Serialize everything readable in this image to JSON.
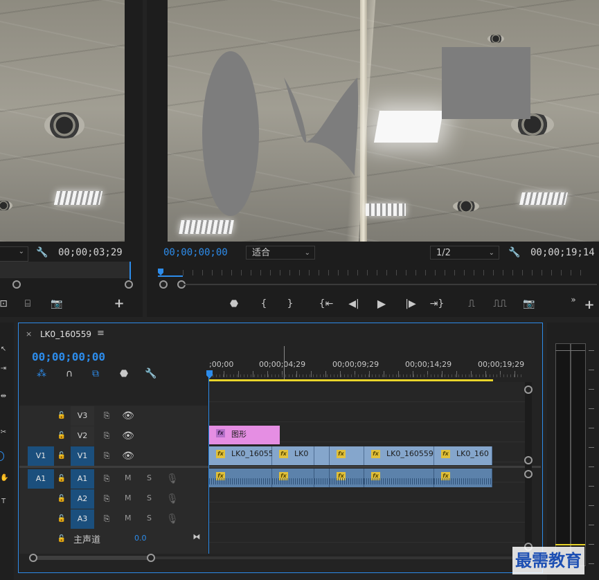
{
  "source_monitor": {
    "fit_value": "",
    "timecode": "00;00;03;29"
  },
  "program_monitor": {
    "playhead_timecode": "00;00;00;00",
    "fit_label": "适合",
    "resolution": "1/2",
    "duration_timecode": "00;00;19;14"
  },
  "timeline": {
    "sequence_name": "LK0_160559",
    "playhead_timecode": "00;00;00;00",
    "ruler_labels": [
      ";00;00",
      "00;00;04;29",
      "00;00;09;29",
      "00;00;14;29",
      "00;00;19;29"
    ],
    "tracks": {
      "v3": "V3",
      "v2": "V2",
      "v1": "V1",
      "v1_source": "V1",
      "a1": "A1",
      "a1_source": "A1",
      "a2": "A2",
      "a3": "A3",
      "mute": "M",
      "solo": "S",
      "master_label": "主声道",
      "master_value": "0.0"
    },
    "clips": {
      "graphic": "图形",
      "v1_clip_1": "LK0_16055",
      "v1_clip_2": "LK0",
      "v1_clip_3": "",
      "v1_clip_4": "LK0_160559.",
      "v1_clip_5": "LK0_160"
    }
  },
  "watermark": "最需教育",
  "colors": {
    "accent_blue": "#2d8ceb",
    "graphic_clip": "#e58ee3",
    "video_clip": "#85a6cc",
    "audio_clip": "#5c82ab",
    "work_area": "#e8d42a"
  }
}
